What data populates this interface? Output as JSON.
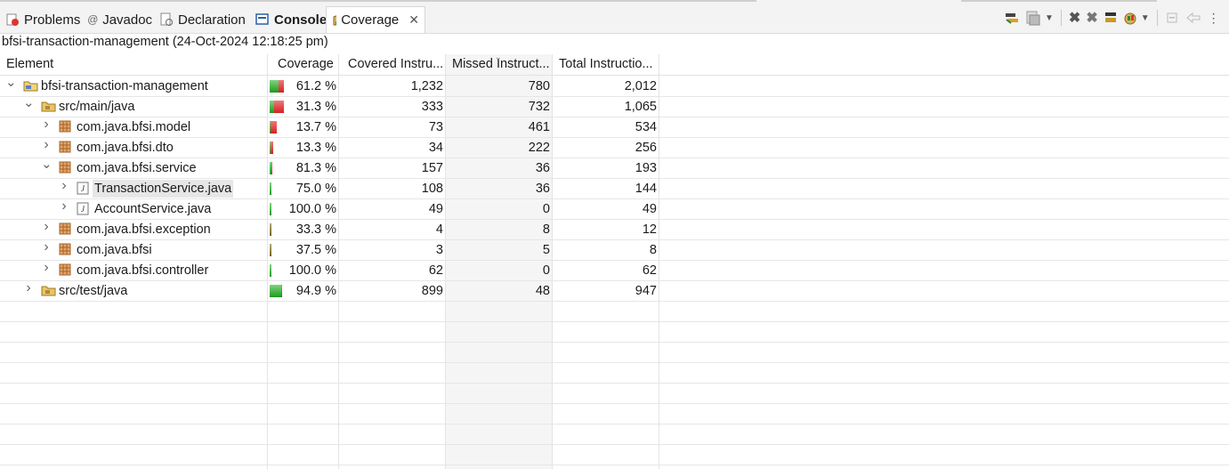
{
  "tabs": [
    {
      "label": "Problems",
      "icon": "problems-icon"
    },
    {
      "label": "Javadoc",
      "icon": "javadoc-icon"
    },
    {
      "label": "Declaration",
      "icon": "declaration-icon"
    },
    {
      "label": "Console",
      "icon": "console-icon"
    },
    {
      "label": "Coverage",
      "icon": "coverage-icon"
    }
  ],
  "toolbar_icons": [
    "relaunch-icon",
    "dump-execution-data-icon",
    "dropdown-arrow-icon",
    "remove-session-icon",
    "remove-all-sessions-icon",
    "merge-sessions-icon",
    "select-session-icon",
    "dropdown-arrow-icon",
    "collapse-all-icon",
    "link-with-selection-icon",
    "view-menu-icon"
  ],
  "session_title": "bfsi-transaction-management (24-Oct-2024 12:18:25 pm)",
  "columns": [
    "Element",
    "Coverage",
    "Covered Instru...",
    "Missed Instruct...",
    "Total Instructio..."
  ],
  "colors": {
    "covered": "#2ea02e",
    "missed": "#e03030",
    "selection": "#e6e6e6"
  },
  "rows": [
    {
      "name": "bfsi-transaction-management",
      "type": "project",
      "expander": "expanded",
      "coverage": "61.2 %",
      "covered": "1,232",
      "missed": "780",
      "total": "2,012",
      "covered_fraction": 0.612
    },
    {
      "name": "src/main/java",
      "type": "source-folder",
      "expander": "expanded",
      "coverage": "31.3 %",
      "covered": "333",
      "missed": "732",
      "total": "1,065",
      "covered_fraction": 0.313
    },
    {
      "name": "com.java.bfsi.model",
      "type": "package",
      "expander": "collapsed",
      "coverage": "13.7 %",
      "covered": "73",
      "missed": "461",
      "total": "534",
      "covered_fraction": 0.137
    },
    {
      "name": "com.java.bfsi.dto",
      "type": "package",
      "expander": "collapsed",
      "coverage": "13.3 %",
      "covered": "34",
      "missed": "222",
      "total": "256",
      "covered_fraction": 0.133
    },
    {
      "name": "com.java.bfsi.service",
      "type": "package",
      "expander": "expanded",
      "coverage": "81.3 %",
      "covered": "157",
      "missed": "36",
      "total": "193",
      "covered_fraction": 0.813
    },
    {
      "name": "TransactionService.java",
      "type": "java-file",
      "expander": "collapsed",
      "coverage": "75.0 %",
      "covered": "108",
      "missed": "36",
      "total": "144",
      "covered_fraction": 0.75,
      "selected": true
    },
    {
      "name": "AccountService.java",
      "type": "java-file",
      "expander": "collapsed",
      "coverage": "100.0 %",
      "covered": "49",
      "missed": "0",
      "total": "49",
      "covered_fraction": 1.0
    },
    {
      "name": "com.java.bfsi.exception",
      "type": "package",
      "expander": "collapsed",
      "coverage": "33.3 %",
      "covered": "4",
      "missed": "8",
      "total": "12",
      "covered_fraction": 0.333
    },
    {
      "name": "com.java.bfsi",
      "type": "package",
      "expander": "collapsed",
      "coverage": "37.5 %",
      "covered": "3",
      "missed": "5",
      "total": "8",
      "covered_fraction": 0.375
    },
    {
      "name": "com.java.bfsi.controller",
      "type": "package",
      "expander": "collapsed",
      "coverage": "100.0 %",
      "covered": "62",
      "missed": "0",
      "total": "62",
      "covered_fraction": 1.0
    },
    {
      "name": "src/test/java",
      "type": "source-folder",
      "expander": "collapsed",
      "coverage": "94.9 %",
      "covered": "899",
      "missed": "48",
      "total": "947",
      "covered_fraction": 0.949
    }
  ]
}
